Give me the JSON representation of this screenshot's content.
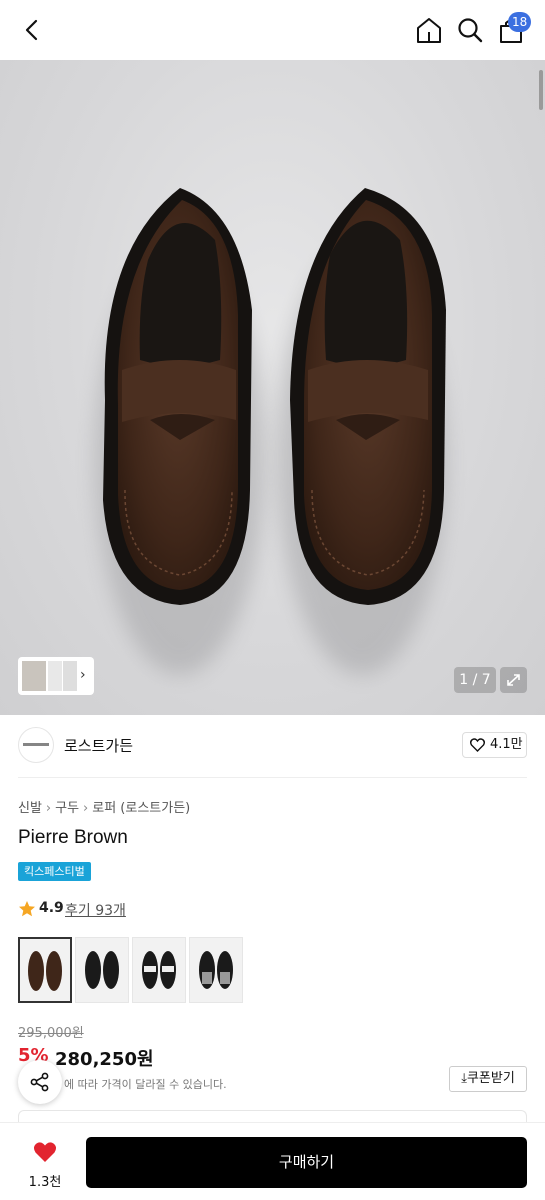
{
  "header": {
    "cart_count": "18",
    "icons": [
      "back-arrow-icon",
      "home-icon",
      "search-icon",
      "cart-icon"
    ]
  },
  "gallery": {
    "counter": "1 / 7"
  },
  "brand": {
    "name": "로스트가든",
    "follow_count": "4.1만"
  },
  "breadcrumb": [
    "신발",
    "구두",
    "로퍼 (로스트가든)"
  ],
  "product": {
    "title": "Pierre Brown",
    "tag": "킥스페스티벌",
    "rating": "4.9",
    "reviews": "후기 93개"
  },
  "price": {
    "original": "295,000원",
    "discount": "5%",
    "current": "280,250원",
    "note": "에 따라 가격이 달라질 수 있습니다.",
    "coupon_label": "쿠폰받기"
  },
  "bottom": {
    "like_count": "1.3천",
    "buy_label": "구매하기"
  },
  "colors": {
    "discount": "#e2242f",
    "tag": "#1aa3d8",
    "badge": "#3b6fe0",
    "like": "#e2242f"
  }
}
